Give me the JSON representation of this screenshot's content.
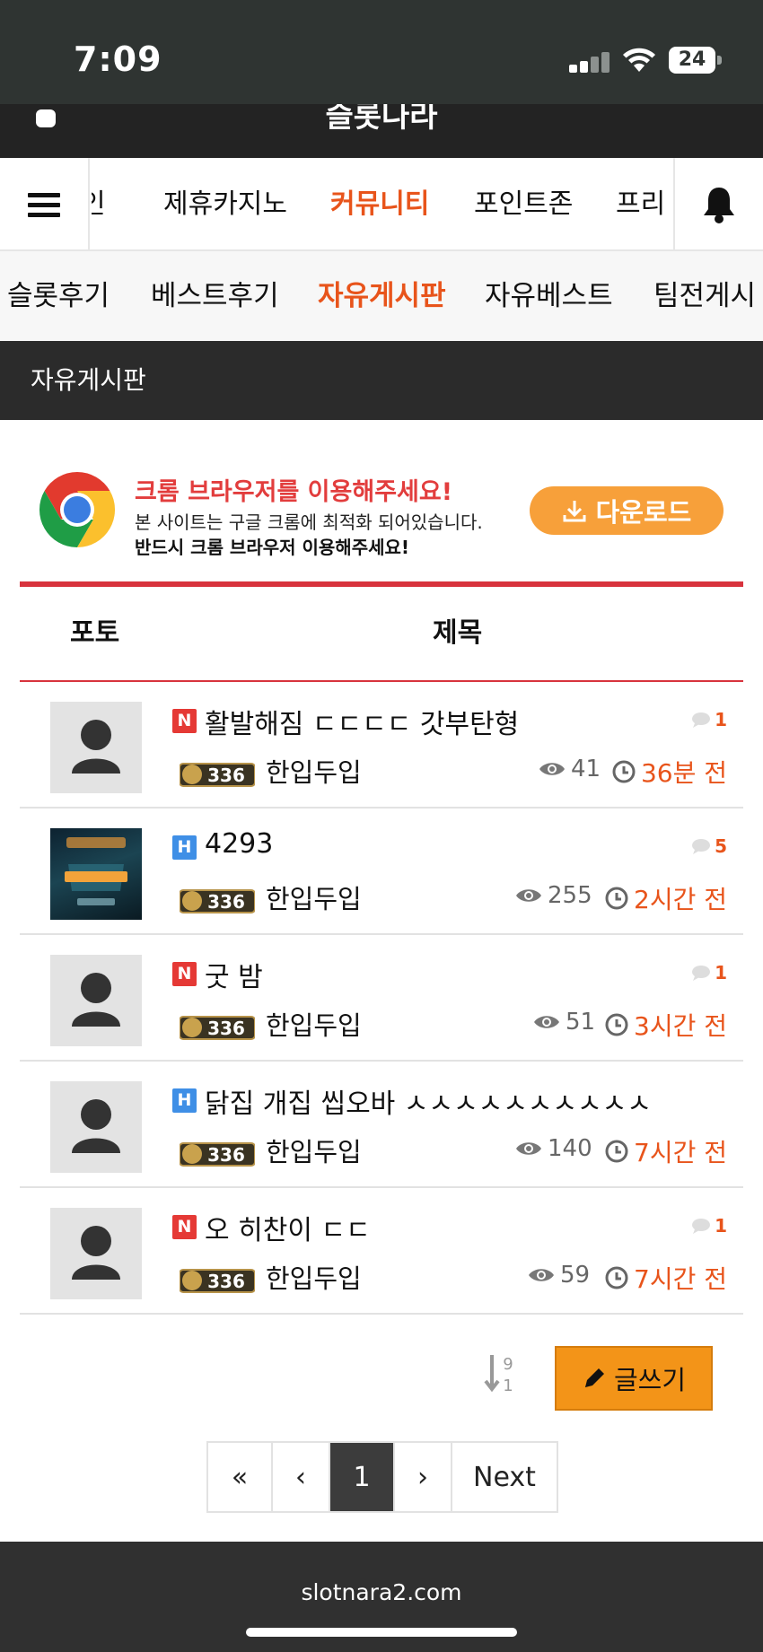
{
  "status_bar": {
    "time": "7:09",
    "battery": "24"
  },
  "header": {
    "logo_text": "슬롯나라"
  },
  "main_nav": {
    "items": [
      {
        "label": "인"
      },
      {
        "label": "제휴카지노"
      },
      {
        "label": "커뮤니티",
        "active": true
      },
      {
        "label": "포인트존"
      },
      {
        "label": "프리"
      }
    ]
  },
  "sub_nav": {
    "items": [
      {
        "label": "슬롯후기"
      },
      {
        "label": "베스트후기"
      },
      {
        "label": "자유게시판",
        "active": true
      },
      {
        "label": "자유베스트"
      },
      {
        "label": "팀전게시"
      }
    ]
  },
  "board": {
    "title": "자유게시판"
  },
  "banner": {
    "title": "크롬 브라우저를 이용해주세요!",
    "line1": "본 사이트는 구글 크롬에 최적화 되어있습니다.",
    "line2": "반드시 크롬 브라우저 이용해주세요!",
    "button": "다운로드"
  },
  "table": {
    "col_photo": "포토",
    "col_title": "제목"
  },
  "posts": [
    {
      "badge": "N",
      "title": "활발해짐 ㄷㄷㄷㄷ 갓부탄형",
      "comments": "1",
      "level": "336",
      "author": "한입두입",
      "views": "41",
      "time": "36분 전"
    },
    {
      "badge": "H",
      "title": "4293",
      "comments": "5",
      "level": "336",
      "author": "한입두입",
      "views": "255",
      "time": "2시간 전"
    },
    {
      "badge": "N",
      "title": "굿 밤",
      "comments": "1",
      "level": "336",
      "author": "한입두입",
      "views": "51",
      "time": "3시간 전"
    },
    {
      "badge": "H",
      "title": "닭집 개집 씹오바 ㅅㅅㅅㅅㅅㅅㅅㅅㅅㅅ",
      "comments": "",
      "level": "336",
      "author": "한입두입",
      "views": "140",
      "time": "7시간 전"
    },
    {
      "badge": "N",
      "title": "오 히찬이 ㄷㄷ",
      "comments": "1",
      "level": "336",
      "author": "한입두입",
      "views": "59",
      "time": "7시간 전"
    }
  ],
  "actions": {
    "sort_top": "9",
    "sort_bottom": "1",
    "write_label": "글쓰기"
  },
  "pagination": {
    "first": "«",
    "prev": "‹",
    "current": "1",
    "next_arrow": "›",
    "next_label": "Next"
  },
  "footer": {
    "domain": "slotnara2.com"
  },
  "colors": {
    "accent": "#e8541b",
    "header_dark": "#2b2b2b",
    "banner_red": "#d8333d",
    "write_button": "#f39418"
  }
}
